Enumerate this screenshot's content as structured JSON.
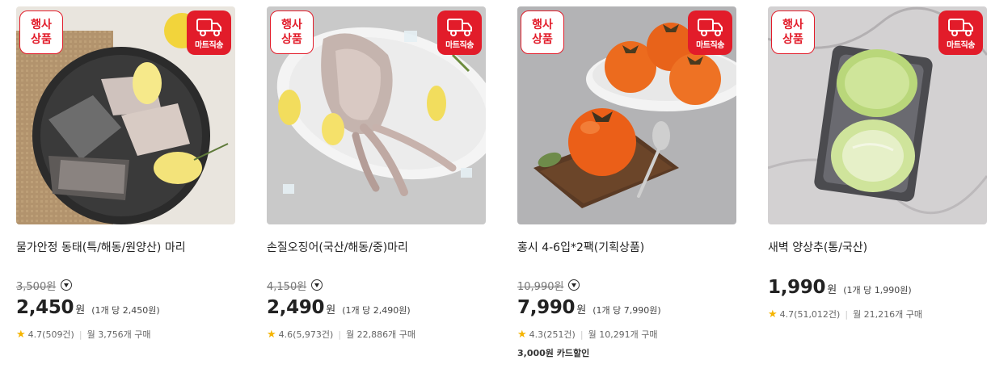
{
  "badges": {
    "event_line1": "행사",
    "event_line2": "상품",
    "shipping": "마트직송"
  },
  "products": [
    {
      "title": "물가안정 동태(특/해동/원양산) 마리",
      "original_price": "3,500원",
      "price": "2,450",
      "won": "원",
      "unit_price": "(1개 당 2,450원)",
      "rating": "4.7(509건)",
      "monthly": "월 3,756개 구매",
      "promo": ""
    },
    {
      "title": "손질오징어(국산/해동/중)마리",
      "original_price": "4,150원",
      "price": "2,490",
      "won": "원",
      "unit_price": "(1개 당 2,490원)",
      "rating": "4.6(5,973건)",
      "monthly": "월 22,886개 구매",
      "promo": ""
    },
    {
      "title": "홍시 4-6입*2팩(기획상품)",
      "original_price": "10,990원",
      "price": "7,990",
      "won": "원",
      "unit_price": "(1개 당 7,990원)",
      "rating": "4.3(251건)",
      "monthly": "월 10,291개 구매",
      "promo": "3,000원 카드할인"
    },
    {
      "title": "새벽 양상추(통/국산)",
      "original_price": "",
      "price": "1,990",
      "won": "원",
      "unit_price": "(1개 당 1,990원)",
      "rating": "4.7(51,012건)",
      "monthly": "월 21,216개 구매",
      "promo": ""
    }
  ]
}
